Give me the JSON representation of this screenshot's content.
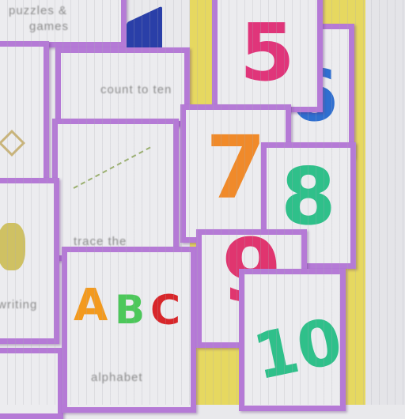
{
  "tiles": [
    {
      "id": "puzzles",
      "caption_1": "puzzles &",
      "caption_2": "games"
    },
    {
      "id": "count",
      "caption": "count to ten"
    },
    {
      "id": "trace",
      "caption": "trace the"
    },
    {
      "id": "alphabet",
      "letters": [
        "A",
        "B",
        "C"
      ],
      "caption": "alphabet"
    },
    {
      "id": "writing",
      "caption": "writing"
    },
    {
      "id": "n5",
      "number": "5"
    },
    {
      "id": "n6",
      "number": "6"
    },
    {
      "id": "n7",
      "number": "7"
    },
    {
      "id": "n8",
      "number": "8"
    },
    {
      "id": "n9",
      "number": "9"
    },
    {
      "id": "n10",
      "number": "10"
    }
  ],
  "colors": {
    "frame": "#b57ad6",
    "five": "#e0357a",
    "six": "#2f6fd0",
    "seven": "#f08a2a",
    "eight": "#2fc08a",
    "nine": "#e0356f",
    "ten_1": "#2fc08a",
    "ten_0": "#d62a2a",
    "a": "#f39a1e",
    "b": "#4cc85a",
    "c": "#d8262a"
  }
}
